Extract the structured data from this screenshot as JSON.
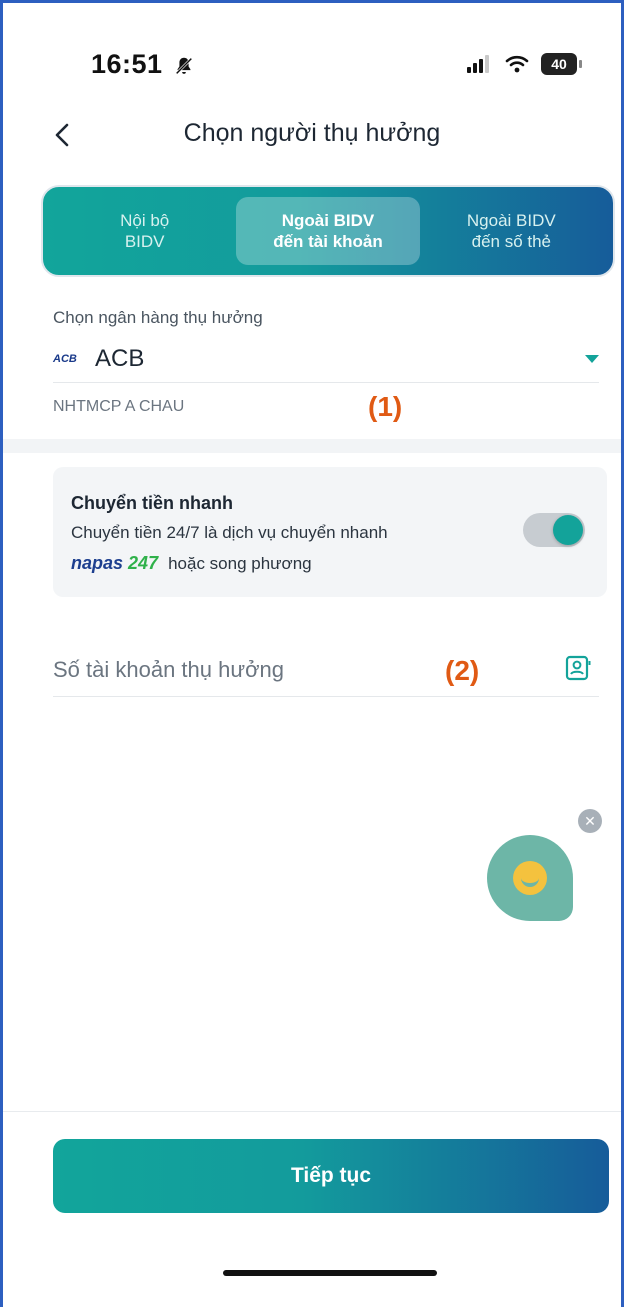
{
  "status_bar": {
    "time": "16:51",
    "battery": "40",
    "icons": [
      "bell-slash-icon",
      "signal-icon",
      "wifi-icon",
      "battery-icon"
    ]
  },
  "header": {
    "title": "Chọn người thụ hưởng",
    "back_icon": "chevron-left-icon"
  },
  "tabs": [
    {
      "line1": "Nội bộ",
      "line2": "BIDV",
      "active": false
    },
    {
      "line1": "Ngoài BIDV",
      "line2": "đến tài khoản",
      "active": true
    },
    {
      "line1": "Ngoài BIDV",
      "line2": "đến số thẻ",
      "active": false
    }
  ],
  "bank": {
    "label": "Chọn ngân hàng thụ hưởng",
    "logo_text": "ACB",
    "name": "ACB",
    "full_name": "NHTMCP A CHAU",
    "dropdown_icon": "caret-down-icon"
  },
  "annotations": {
    "one": "(1)",
    "two": "(2)"
  },
  "fast_transfer": {
    "title": "Chuyển tiền nhanh",
    "desc_line1": "Chuyển tiền 24/7 là dịch vụ chuyển nhanh",
    "napas_part1": "napas",
    "napas_part2": "247",
    "desc_line2_suffix": "hoặc song phương",
    "toggle_on": true
  },
  "account": {
    "placeholder": "Số tài khoản thụ hưởng",
    "contact_icon": "contact-book-icon"
  },
  "chat": {
    "close_icon": "close-icon",
    "bot_icon": "chat-bot-icon"
  },
  "footer": {
    "continue_label": "Tiếp tục"
  },
  "colors": {
    "accent": "#13a39a",
    "gradient_end": "#165c9a",
    "annotation": "#e05a14"
  }
}
